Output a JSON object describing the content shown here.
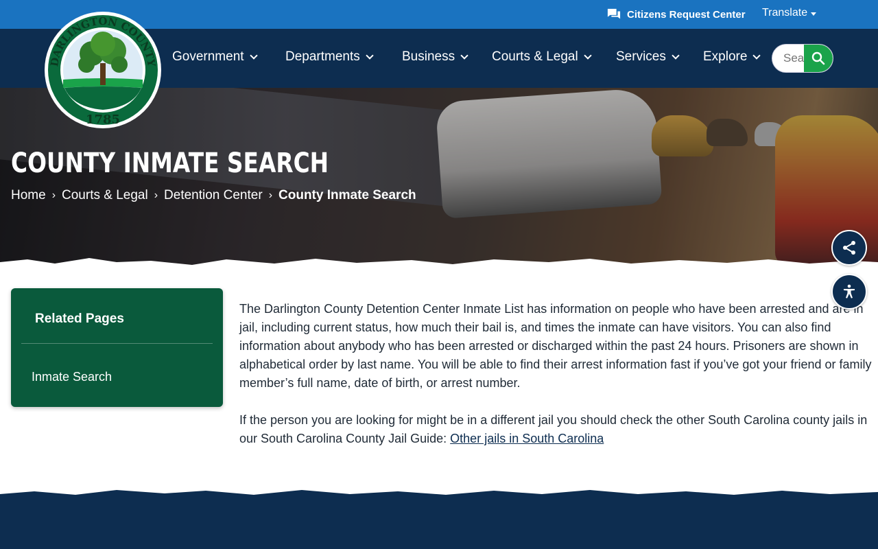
{
  "topbar": {
    "request_label": "Citizens Request Center",
    "translate_label": "Translate"
  },
  "logo": {
    "alt": "Darlington County 1785 seal",
    "text_top": "DARLINGTON COUNTY",
    "year": "1785"
  },
  "nav": {
    "items": [
      {
        "label": "Government"
      },
      {
        "label": "Departments"
      },
      {
        "label": "Business"
      },
      {
        "label": "Courts & Legal"
      },
      {
        "label": "Services"
      },
      {
        "label": "Explore"
      }
    ],
    "search_placeholder": "Search"
  },
  "hero": {
    "title": "COUNTY INMATE SEARCH",
    "breadcrumbs": [
      "Home",
      "Courts & Legal",
      "Detention Center",
      "County Inmate Search"
    ]
  },
  "sidebar": {
    "heading": "Related Pages",
    "links": [
      "Inmate Search"
    ]
  },
  "content": {
    "paragraph1": "The Darlington County Detention Center Inmate List has information on people who have been arrested and are in jail, including current status, how much their bail is, and times the inmate can have visitors. You can also find information about anybody who has been arrested or discharged within the past 24 hours. Prisoners are shown in alphabetical order by last name. You will be able to find their arrest information fast if you’ve got your friend or family member’s full name, date of birth, or arrest number.",
    "paragraph2_text": "If the person you are looking for might be in a different jail you should check the other South Carolina county jails in our South Carolina County Jail Guide: ",
    "paragraph2_link": "Other jails in South Carolina"
  },
  "colors": {
    "topbar": "#1a73c0",
    "navbar": "#0d2d50",
    "sidebar": "#0a5a3c",
    "search_button": "#1aa34a"
  },
  "icons": [
    "chat-icon",
    "caret-down-icon",
    "chevron-down-icon",
    "search-icon",
    "share-icon",
    "accessibility-icon"
  ]
}
